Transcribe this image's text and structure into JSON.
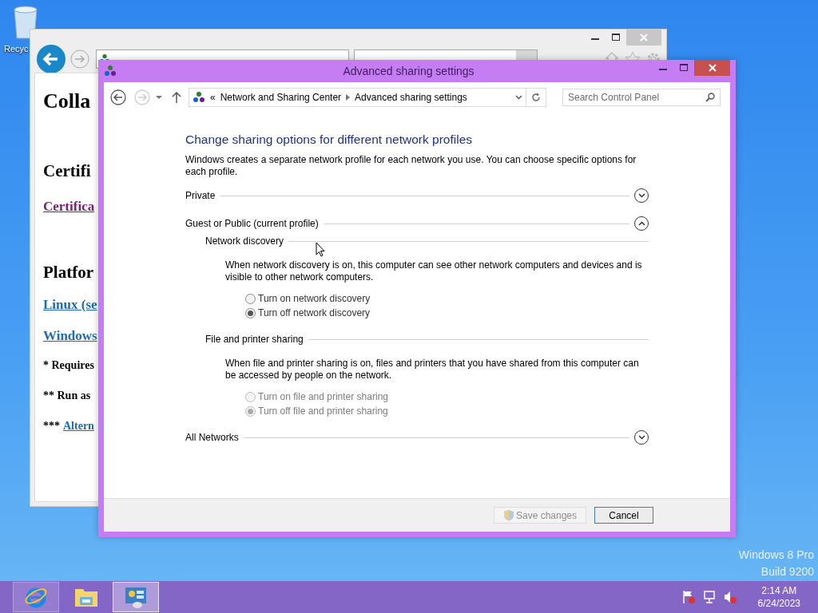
{
  "desktop": {
    "icons": [
      {
        "label": "Recyc"
      }
    ],
    "watermark": [
      "Windows 8 Pro",
      "Build 9200"
    ]
  },
  "browser": {
    "page": [
      {
        "kind": "h1",
        "text": "Colla"
      },
      {
        "kind": "h2",
        "text": "Certifi"
      },
      {
        "kind": "visited_link",
        "text": "Certifica"
      },
      {
        "kind": "h2",
        "text": "Platfor"
      },
      {
        "kind": "link",
        "text": "Linux (se"
      },
      {
        "kind": "link",
        "text": "Windows"
      },
      {
        "kind": "note",
        "text": "* Requires"
      },
      {
        "kind": "note",
        "text": "** Run as"
      },
      {
        "kind": "note_link",
        "prefix": "***",
        "text": "Altern"
      }
    ]
  },
  "dialog": {
    "title": "Advanced sharing settings",
    "nav": {
      "breadcrumb_prefix": "«",
      "breadcrumb": [
        "Network and Sharing Center",
        "Advanced sharing settings"
      ],
      "search": {
        "placeholder": "Search Control Panel"
      }
    },
    "heading": "Change sharing options for different network profiles",
    "description": "Windows creates a separate network profile for each network you use. You can choose specific options for each profile.",
    "sections": [
      {
        "title": "Private",
        "expanded": false
      },
      {
        "title": "Guest or Public (current profile)",
        "expanded": true,
        "groups": [
          {
            "title": "Network discovery",
            "description": "When network discovery is on, this computer can see other network computers and devices and is visible to other network computers.",
            "options": [
              {
                "label": "Turn on network discovery",
                "selected": false,
                "disabled": false
              },
              {
                "label": "Turn off network discovery",
                "selected": true,
                "disabled": false
              }
            ]
          },
          {
            "title": "File and printer sharing",
            "description": "When file and printer sharing is on, files and printers that you have shared from this computer can be accessed by people on the network.",
            "options": [
              {
                "label": "Turn on file and printer sharing",
                "selected": false,
                "disabled": true
              },
              {
                "label": "Turn off file and printer sharing",
                "selected": true,
                "disabled": true
              }
            ]
          }
        ]
      },
      {
        "title": "All Networks",
        "expanded": false
      }
    ],
    "buttons": [
      {
        "label": "Save changes",
        "disabled": true,
        "uac": true
      },
      {
        "label": "Cancel",
        "disabled": false,
        "uac": false
      }
    ]
  },
  "taskbar": {
    "apps": [
      {
        "kind": "ie",
        "running": true,
        "selected": false
      },
      {
        "kind": "explorer",
        "running": false,
        "selected": false
      },
      {
        "kind": "control_panel",
        "running": true,
        "selected": true
      }
    ],
    "clock": {
      "time": "2:14 AM",
      "date": "6/24/2023"
    }
  }
}
